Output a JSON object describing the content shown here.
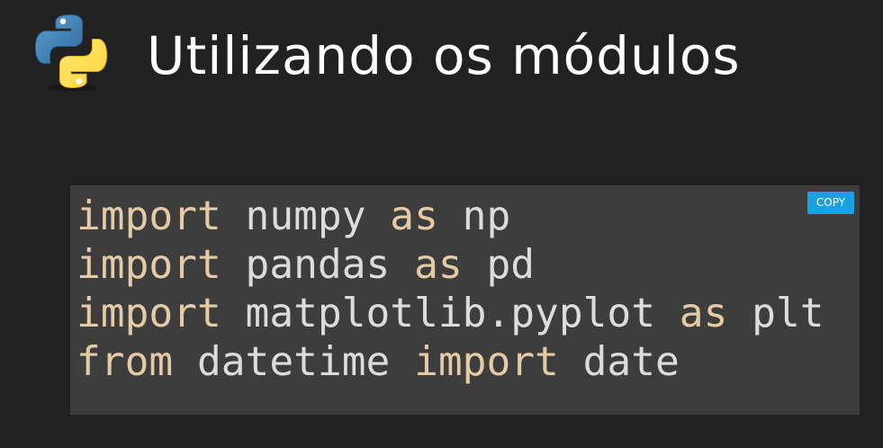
{
  "header": {
    "title": "Utilizando os módulos",
    "logo_icon": "python-logo-icon"
  },
  "code_block": {
    "copy_label": "COPY",
    "lines": [
      [
        {
          "text": "import",
          "kw": true
        },
        {
          "text": " numpy ",
          "kw": false
        },
        {
          "text": "as",
          "kw": true
        },
        {
          "text": " np",
          "kw": false
        }
      ],
      [
        {
          "text": "import",
          "kw": true
        },
        {
          "text": " pandas ",
          "kw": false
        },
        {
          "text": "as",
          "kw": true
        },
        {
          "text": " pd",
          "kw": false
        }
      ],
      [
        {
          "text": "import",
          "kw": true
        },
        {
          "text": " matplotlib.pyplot ",
          "kw": false
        },
        {
          "text": "as",
          "kw": true
        },
        {
          "text": " plt",
          "kw": false
        }
      ],
      [
        {
          "text": "from",
          "kw": true
        },
        {
          "text": " datetime ",
          "kw": false
        },
        {
          "text": "import",
          "kw": true
        },
        {
          "text": " date",
          "kw": false
        }
      ]
    ]
  },
  "colors": {
    "background": "#212121",
    "code_background": "#3d3d3d",
    "code_text": "#dcdcdc",
    "keyword": "#e5caa6",
    "copy_button": "#1ba1e2",
    "python_blue": "#3d74a9",
    "python_yellow": "#ffd940"
  }
}
